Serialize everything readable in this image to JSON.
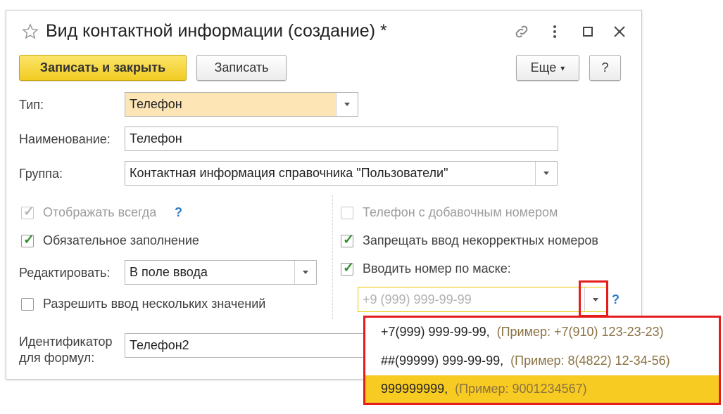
{
  "window": {
    "title": "Вид контактной информации (создание) *"
  },
  "toolbar": {
    "save_close_label": "Записать и закрыть",
    "save_label": "Записать",
    "more_label": "Еще",
    "more_arrow": "▾",
    "help_label": "?"
  },
  "form": {
    "type_label": "Тип:",
    "type_value": "Телефон",
    "name_label": "Наименование:",
    "name_value": "Телефон",
    "group_label": "Группа:",
    "group_value": "Контактная информация справочника \"Пользователи\"",
    "show_always_label": "Отображать всегда",
    "show_always_help": "?",
    "required_label": "Обязательное заполнение",
    "edit_label": "Редактировать:",
    "edit_value": "В поле ввода",
    "multiple_label": "Разрешить ввод нескольких значений",
    "ext_phone_label": "Телефон с добавочным номером",
    "forbid_incorrect_label": "Запрещать ввод некорректных номеров",
    "mask_label": "Вводить номер по маске:",
    "mask_placeholder": "+9 (999) 999-99-99",
    "mask_help": "?",
    "identifier_label_1": "Идентификатор",
    "identifier_label_2": "для формул:",
    "identifier_value": "Телефон2"
  },
  "checkboxes": {
    "show_always": true,
    "required": true,
    "multiple": false,
    "ext_phone": false,
    "forbid_incorrect": true,
    "mask": true
  },
  "mask_options": [
    {
      "mask": "+7(999) 999-99-99,",
      "example": "(Пример: +7(910) 123-23-23)",
      "selected": false
    },
    {
      "mask": "##(99999) 999-99-99,",
      "example": "(Пример: 8(4822) 12-34-56)",
      "selected": false
    },
    {
      "mask": "999999999,",
      "example": "(Пример: 9001234567)",
      "selected": true
    }
  ],
  "colors": {
    "accent_yellow": "#f2cc22",
    "highlight_field": "#fde5b6",
    "checkmark_green": "#2f8f2f",
    "annotation_red": "#e51c1c",
    "help_blue": "#2c7ac9"
  },
  "icons": [
    "star-icon",
    "link-icon",
    "more-vertical-icon",
    "maximize-icon",
    "close-icon"
  ]
}
